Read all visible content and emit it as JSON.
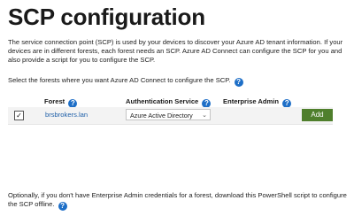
{
  "page": {
    "title": "SCP configuration",
    "description": "The service connection point (SCP) is used by your devices to discover your Azure AD tenant information.  If your devices are in different forests, each forest needs an SCP.  Azure AD Connect can configure the SCP for you and also provide a script for you to configure the SCP.",
    "prompt": "Select the forests where you want Azure AD Connect to configure the SCP.",
    "footer": "Optionally, if you don't have Enterprise Admin credentials for a forest, download this PowerShell script to configure the SCP offline."
  },
  "table": {
    "columns": [
      "Forest",
      "Authentication Service",
      "Enterprise Admin"
    ],
    "rows": [
      {
        "checked": true,
        "forest": "brsbrokers.lan",
        "auth_service": "Azure Active Directory",
        "action": "Add"
      }
    ]
  },
  "icons": {
    "help": "help-question-icon",
    "checkmark": "checkmark-icon",
    "dropdown": "chevron-down-icon"
  },
  "colors": {
    "help_icon": "#1e6fc7",
    "add_button": "#4f7f2c",
    "link": "#1e5fa8"
  }
}
